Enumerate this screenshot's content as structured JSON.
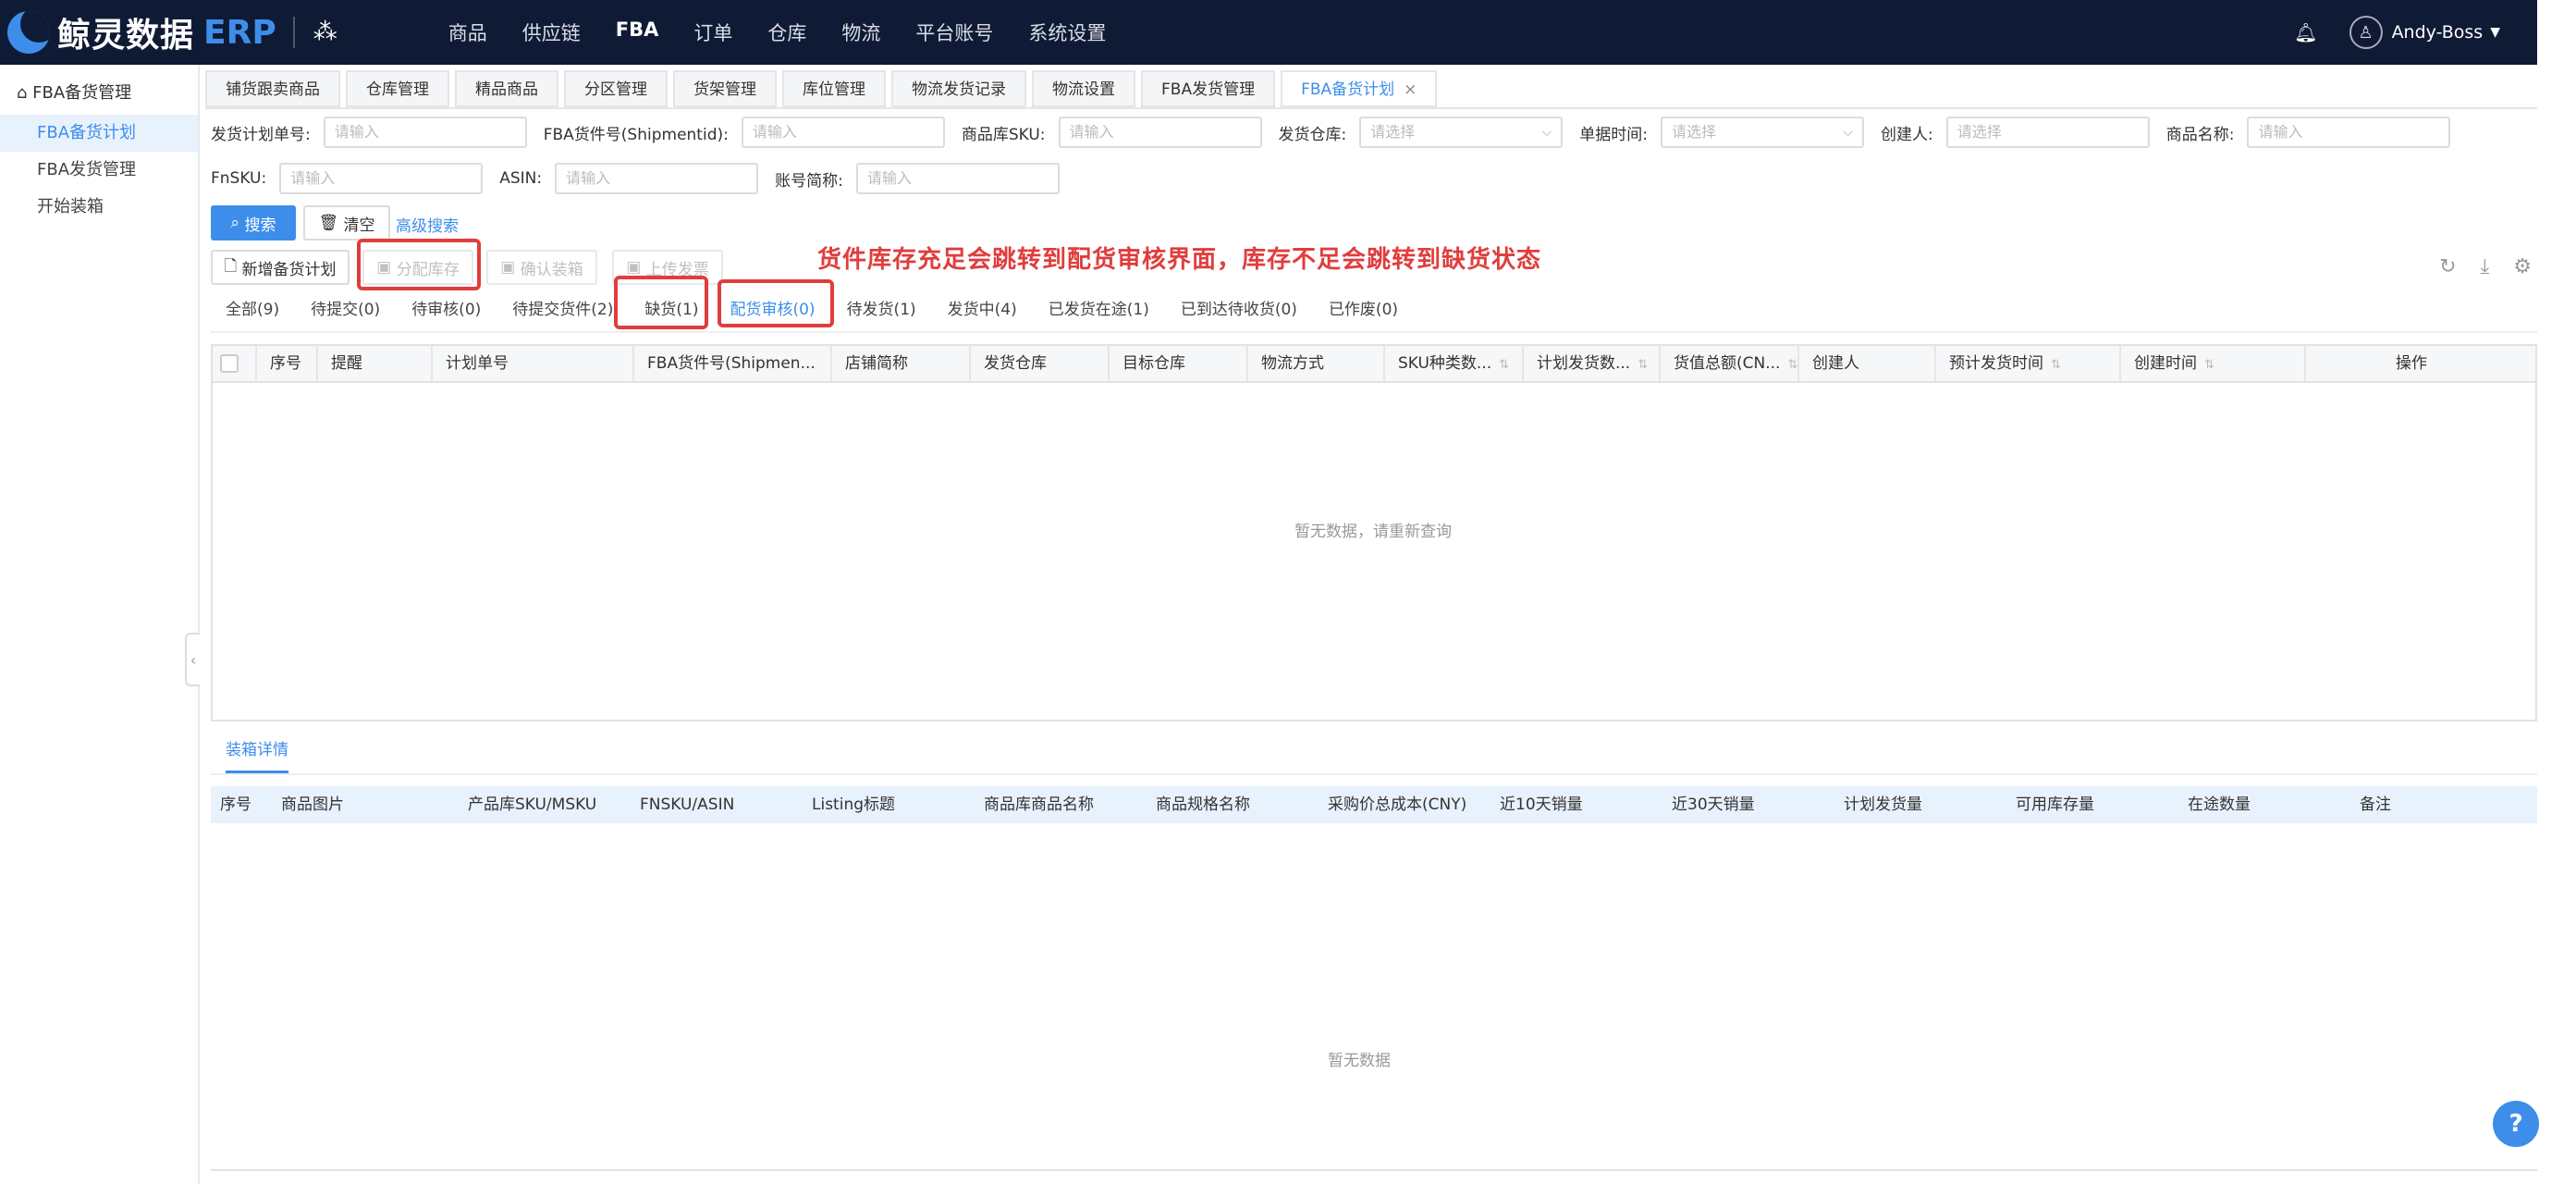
{
  "topbar": {
    "logo_text": "鲸灵数据",
    "logo_erp": "ERP",
    "nav": [
      "商品",
      "供应链",
      "FBA",
      "订单",
      "仓库",
      "物流",
      "平台账号",
      "系统设置"
    ],
    "user": "Andy-Boss"
  },
  "sidebar": {
    "title": "FBA备货管理",
    "items": [
      "FBA备货计划",
      "FBA发货管理",
      "开始装箱"
    ]
  },
  "tabs": [
    "铺货跟卖商品",
    "仓库管理",
    "精品商品",
    "分区管理",
    "货架管理",
    "库位管理",
    "物流发货记录",
    "物流设置",
    "FBA发货管理",
    "FBA备货计划"
  ],
  "filters": {
    "plan_no": {
      "label": "发货计划单号:",
      "placeholder": "请输入"
    },
    "shipment_id": {
      "label": "FBA货件号(Shipmentid):",
      "placeholder": "请输入"
    },
    "sku": {
      "label": "商品库SKU:",
      "placeholder": "请输入"
    },
    "warehouse": {
      "label": "发货仓库:",
      "placeholder": "请选择"
    },
    "date": {
      "label": "单据时间:",
      "placeholder": "请选择"
    },
    "creator": {
      "label": "创建人:",
      "placeholder": "请选择"
    },
    "product_name": {
      "label": "商品名称:",
      "placeholder": "请输入"
    },
    "fnsku": {
      "label": "FnSKU:",
      "placeholder": "请输入"
    },
    "asin": {
      "label": "ASIN:",
      "placeholder": "请输入"
    },
    "account": {
      "label": "账号简称:",
      "placeholder": "请输入"
    }
  },
  "buttons": {
    "search": "搜索",
    "clear": "清空",
    "advanced": "高级搜索",
    "new_plan": "新增备货计划",
    "allocate": "分配库存",
    "confirm_box": "确认装箱",
    "upload_invoice": "上传发票"
  },
  "annotation": "货件库存充足会跳转到配货审核界面，库存不足会跳转到缺货状态",
  "status_tabs": [
    "全部(9)",
    "待提交(0)",
    "待审核(0)",
    "待提交货件(2)",
    "缺货(1)",
    "配货审核(0)",
    "待发货(1)",
    "发货中(4)",
    "已发货在途(1)",
    "已到达待收货(0)",
    "已作废(0)"
  ],
  "table": {
    "columns": [
      "序号",
      "提醒",
      "计划单号",
      "FBA货件号(Shipmen...",
      "店铺简称",
      "发货仓库",
      "目标仓库",
      "物流方式",
      "SKU种类数...",
      "计划发货数...",
      "货值总额(CN...",
      "创建人",
      "预计发货时间",
      "创建时间",
      "操作"
    ],
    "empty": "暂无数据，请重新查询"
  },
  "detail": {
    "tab": "装箱详情",
    "columns": [
      "序号",
      "商品图片",
      "产品库SKU/MSKU",
      "FNSKU/ASIN",
      "Listing标题",
      "商品库商品名称",
      "商品规格名称",
      "采购价总成本(CNY)",
      "近10天销量",
      "近30天销量",
      "计划发货量",
      "可用库存量",
      "在途数量",
      "备注"
    ],
    "empty": "暂无数据"
  },
  "colors": {
    "primary": "#3d8eea",
    "topbar": "#0f1a35",
    "annotation": "#e03d3d"
  }
}
